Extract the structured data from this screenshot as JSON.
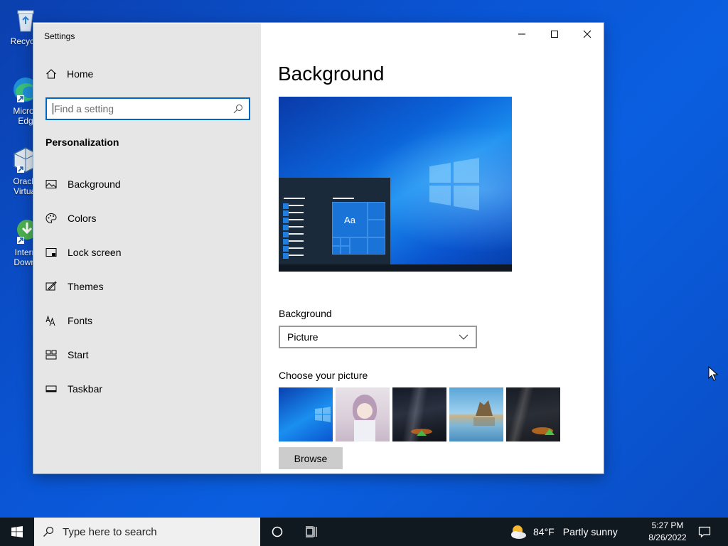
{
  "desktop": {
    "icons": [
      {
        "label": "Recycle",
        "icon": "recycle-bin-icon"
      },
      {
        "label": "Micros",
        "label2": "Edg",
        "icon": "edge-icon"
      },
      {
        "label": "Oracle",
        "label2": "Virtual",
        "icon": "virtualbox-icon"
      },
      {
        "label": "Intern",
        "label2": "Downl",
        "icon": "download-manager-icon"
      }
    ]
  },
  "window": {
    "title": "Settings",
    "caption": {
      "minimize": "minimize-icon",
      "maximize": "maximize-icon",
      "close": "close-icon"
    }
  },
  "sidebar": {
    "home_label": "Home",
    "search_placeholder": "Find a setting",
    "section_heading": "Personalization",
    "items": [
      {
        "label": "Background",
        "icon": "picture-icon"
      },
      {
        "label": "Colors",
        "icon": "palette-icon"
      },
      {
        "label": "Lock screen",
        "icon": "lock-screen-icon"
      },
      {
        "label": "Themes",
        "icon": "themes-icon"
      },
      {
        "label": "Fonts",
        "icon": "fonts-icon"
      },
      {
        "label": "Start",
        "icon": "start-icon"
      },
      {
        "label": "Taskbar",
        "icon": "taskbar-icon"
      }
    ]
  },
  "main": {
    "title": "Background",
    "preview_tile_text": "Aa",
    "background_label": "Background",
    "background_value": "Picture",
    "choose_label": "Choose your picture",
    "browse_label": "Browse"
  },
  "taskbar": {
    "search_placeholder": "Type here to search",
    "weather_temp": "84°F",
    "weather_desc": "Partly sunny",
    "time": "5:27 PM",
    "date": "8/26/2022"
  },
  "colors": {
    "accent": "#0067c0",
    "sidebar_bg": "#e6e6e6",
    "taskbar_bg": "#101820"
  }
}
